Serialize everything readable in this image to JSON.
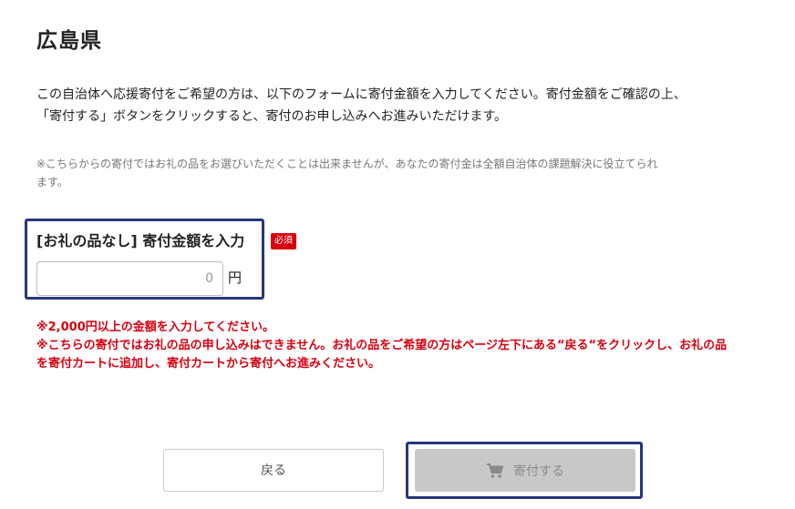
{
  "page": {
    "title": "広島県",
    "lead_line1": "この自治体へ応援寄付をご希望の方は、以下のフォームに寄付金額を入力してください。寄付金額をご確認の上、",
    "lead_line2": "「寄付する」ボタンをクリックすると、寄付のお申し込みへお進みいただけます。",
    "note_line1": "※こちらからの寄付ではお礼の品をお選びいただくことは出来ませんが、あなたの寄付金は全額自治体の課題解決に役立てられ",
    "note_line2": "ます。"
  },
  "form": {
    "amount_label": "[お礼の品なし] 寄付金額を入力",
    "required_badge": "必須",
    "amount_value": "0",
    "currency": "円",
    "warning_line1": "※2,000円以上の金額を入力してください。",
    "warning_line2": "※こちらの寄付ではお礼の品の申し込みはできません。お礼の品をご希望の方はページ左下にある“戻る“をクリックし、お礼の品",
    "warning_line3": "を寄付カートに追加し、寄付カートから寄付へお進みください。"
  },
  "actions": {
    "back_label": "戻る",
    "donate_label": "寄付する",
    "donate_icon": "cart-icon"
  },
  "colors": {
    "focus_border": "#24387a",
    "required": "#d7000f",
    "warning": "#d7000f",
    "disabled_button": "#c8c8c8"
  }
}
